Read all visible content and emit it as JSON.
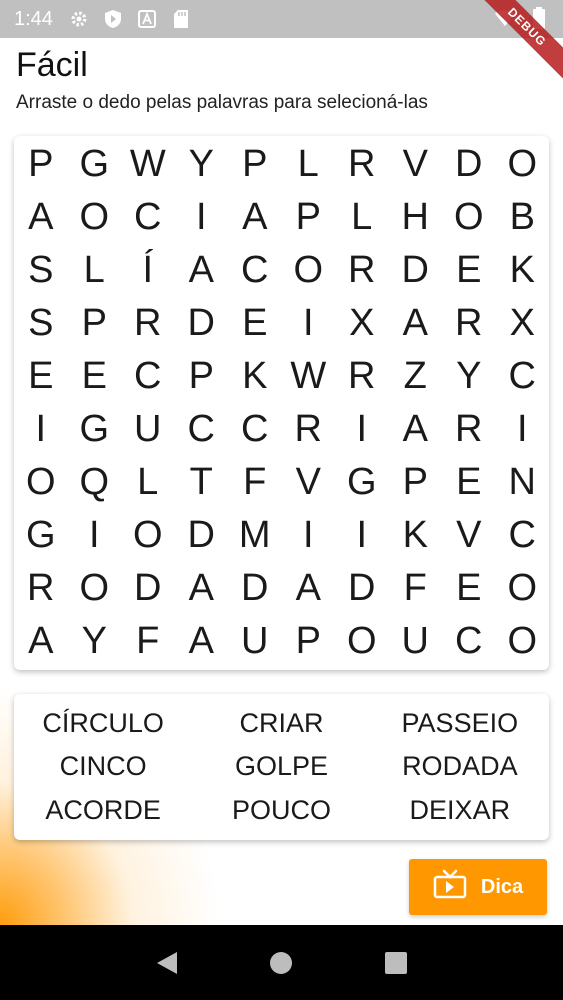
{
  "status_bar": {
    "time": "1:44",
    "debug_label": "DEBUG"
  },
  "header": {
    "title": "Fácil",
    "subtitle": "Arraste o dedo pelas palavras para selecioná-las"
  },
  "grid": [
    [
      "P",
      "G",
      "W",
      "Y",
      "P",
      "L",
      "R",
      "V",
      "D",
      "O"
    ],
    [
      "A",
      "O",
      "C",
      "I",
      "A",
      "P",
      "L",
      "H",
      "O",
      "B"
    ],
    [
      "S",
      "L",
      "Í",
      "A",
      "C",
      "O",
      "R",
      "D",
      "E",
      "K"
    ],
    [
      "S",
      "P",
      "R",
      "D",
      "E",
      "I",
      "X",
      "A",
      "R",
      "X"
    ],
    [
      "E",
      "E",
      "C",
      "P",
      "K",
      "W",
      "R",
      "Z",
      "Y",
      "C"
    ],
    [
      "I",
      "G",
      "U",
      "C",
      "C",
      "R",
      "I",
      "A",
      "R",
      "I"
    ],
    [
      "O",
      "Q",
      "L",
      "T",
      "F",
      "V",
      "G",
      "P",
      "E",
      "N"
    ],
    [
      "G",
      "I",
      "O",
      "D",
      "M",
      "I",
      "I",
      "K",
      "V",
      "C"
    ],
    [
      "R",
      "O",
      "D",
      "A",
      "D",
      "A",
      "D",
      "F",
      "E",
      "O"
    ],
    [
      "A",
      "Y",
      "F",
      "A",
      "U",
      "P",
      "O",
      "U",
      "C",
      "O"
    ]
  ],
  "words": [
    "CÍRCULO",
    "CRIAR",
    "PASSEIO",
    "CINCO",
    "GOLPE",
    "RODADA",
    "ACORDE",
    "POUCO",
    "DEIXAR"
  ],
  "hint_button": {
    "label": "Dica",
    "icon": "tv-icon"
  },
  "colors": {
    "accent": "#ff9800",
    "status_bar": "#c0c0c0",
    "nav_bar": "#000000",
    "debug_ribbon": "#b71c1c"
  }
}
